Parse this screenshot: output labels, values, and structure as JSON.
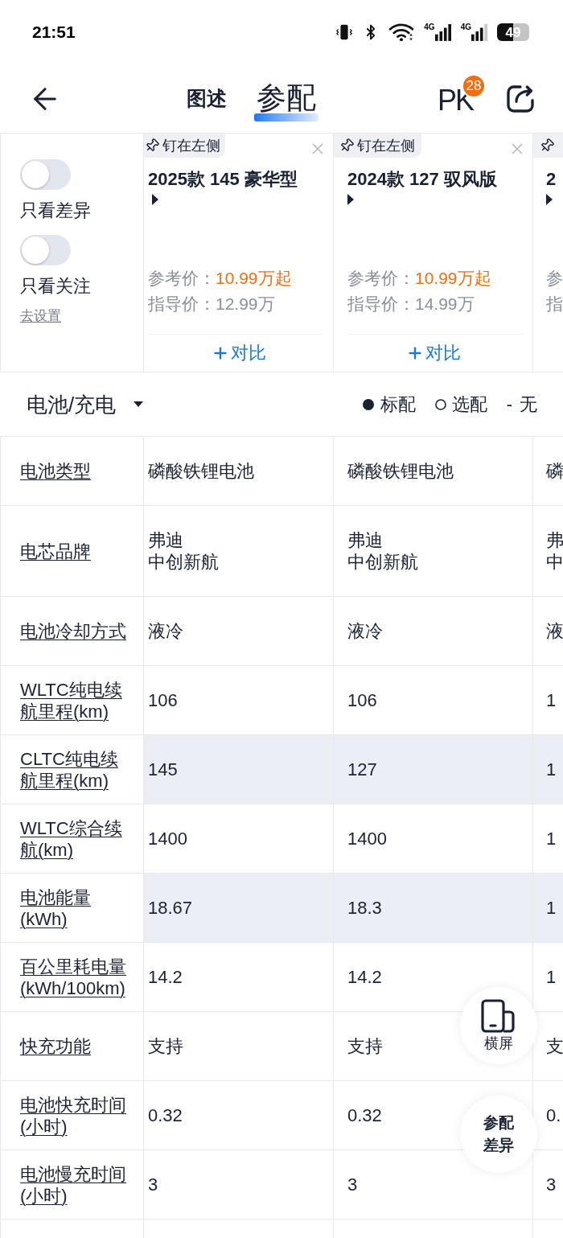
{
  "status_bar": {
    "time": "21:51",
    "networks": [
      {
        "label": "4G"
      },
      {
        "label": "4G"
      }
    ],
    "battery": "49"
  },
  "nav": {
    "tabs": [
      {
        "label": "图述",
        "selected": false
      },
      {
        "label": "参配",
        "selected": true
      }
    ],
    "pk": {
      "label": "PK",
      "badge": "28"
    }
  },
  "filters": {
    "toggles": [
      {
        "label": "只看差异",
        "on": false
      },
      {
        "label": "只看关注",
        "on": false
      }
    ],
    "settings_link": "去设置"
  },
  "cars": [
    {
      "kind": "full",
      "pin": "钉在左侧",
      "title": "2025款 145 豪华型",
      "reference_label": "参考价：",
      "reference_price": "10.99万起",
      "guide_label": "指导价：",
      "guide_price": "12.99万",
      "compare": "对比"
    },
    {
      "kind": "full",
      "pin": "钉在左侧",
      "title": "2024款 127 驭风版",
      "reference_label": "参考价：",
      "reference_price": "10.99万起",
      "guide_label": "指导价：",
      "guide_price": "14.99万",
      "compare": "对比"
    },
    {
      "kind": "edge",
      "title": "2",
      "reference_label": "参",
      "guide_label": "指"
    }
  ],
  "section": {
    "title": "电池/充电",
    "legend": [
      {
        "kind": "standard",
        "label": "标配"
      },
      {
        "kind": "optional",
        "label": "选配"
      },
      {
        "kind": "none",
        "symbol": "-",
        "label": "无"
      }
    ]
  },
  "rows": [
    {
      "label": "电池类型",
      "differs": false,
      "values": [
        "磷酸铁锂电池",
        "磷酸铁锂电池",
        "磷"
      ]
    },
    {
      "label": "电芯品牌",
      "differs": false,
      "values": [
        [
          "弗迪",
          "中创新航"
        ],
        [
          "弗迪",
          "中创新航"
        ],
        [
          "弗",
          "中"
        ]
      ]
    },
    {
      "label": "电池冷却方式",
      "differs": false,
      "values": [
        "液冷",
        "液冷",
        "液"
      ]
    },
    {
      "label": "WLTC纯电续航里程(km)",
      "differs": false,
      "values": [
        "106",
        "106",
        "1"
      ]
    },
    {
      "label": "CLTC纯电续航里程(km)",
      "differs": true,
      "values": [
        "145",
        "127",
        "1"
      ]
    },
    {
      "label": "WLTC综合续航(km)",
      "differs": false,
      "values": [
        "1400",
        "1400",
        "1"
      ]
    },
    {
      "label": "电池能量(kWh)",
      "differs": true,
      "values": [
        "18.67",
        "18.3",
        "1"
      ]
    },
    {
      "label": "百公里耗电量(kWh/100km)",
      "differs": false,
      "values": [
        "14.2",
        "14.2",
        "1"
      ]
    },
    {
      "label": "快充功能",
      "differs": false,
      "values": [
        "支持",
        "支持",
        "支"
      ]
    },
    {
      "label": "电池快充时间(小时)",
      "differs": false,
      "values": [
        "0.32",
        "0.32",
        "0."
      ]
    },
    {
      "label": "电池慢充时间(小时)",
      "differs": false,
      "values": [
        "3",
        "3",
        "3"
      ]
    }
  ],
  "floating_buttons": [
    {
      "kind": "rotate",
      "label": "横屏"
    },
    {
      "kind": "diff",
      "label": "参配差异"
    }
  ]
}
